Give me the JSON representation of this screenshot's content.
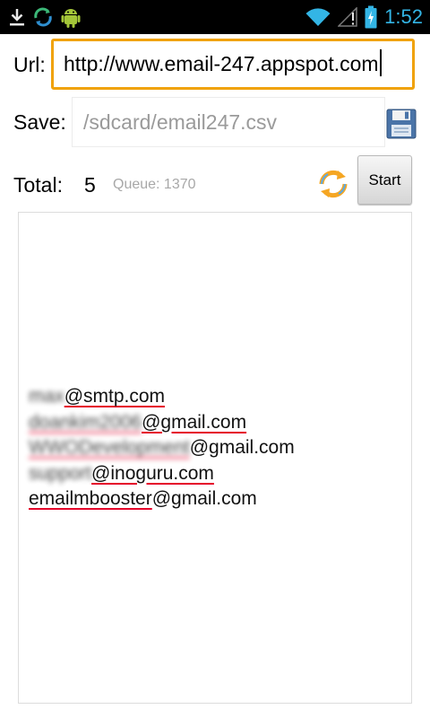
{
  "status_bar": {
    "time": "1:52",
    "left_icons": [
      "download-icon",
      "sync-icon",
      "android-debug-icon"
    ],
    "right_icons": [
      "wifi-icon",
      "signal-icon",
      "battery-charging-icon"
    ],
    "time_color": "#33b5e5"
  },
  "form": {
    "url_label": "Url:",
    "url_value": "http://www.email-247.appspot.com",
    "save_label": "Save:",
    "save_placeholder": "/sdcard/email247.csv",
    "total_label": "Total:",
    "total_value": "5",
    "queue_text": "Queue: 1370",
    "start_label": "Start",
    "save_icon": "floppy-disk-icon",
    "refresh_icon": "refresh-icon",
    "focus_color": "#f0a20a"
  },
  "results": {
    "emails": [
      {
        "hidden": "max",
        "visible": "@smtp.com"
      },
      {
        "hidden": "doankim2006",
        "visible": "@gmail.com"
      },
      {
        "hidden": "WWODevelopment",
        "visible": "@gmail.com"
      },
      {
        "hidden": "support",
        "visible": "@inoguru.com"
      },
      {
        "hidden": "emailmbooster",
        "visible": "@gmail.com"
      }
    ]
  }
}
